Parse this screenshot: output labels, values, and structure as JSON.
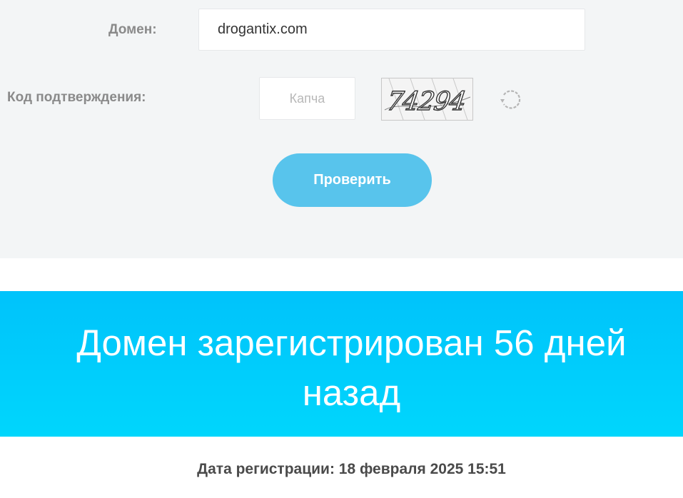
{
  "form": {
    "domain_label": "Домен:",
    "domain_value": "drogantix.com",
    "code_label": "Код подтверждения:",
    "captcha_placeholder": "Капча",
    "captcha_code": "74294",
    "submit_label": "Проверить"
  },
  "result": {
    "headline": "Домен зарегистрирован 56 дней назад",
    "registration_date": "Дата регистрации: 18 февраля 2025 15:51"
  },
  "colors": {
    "button": "#58c4ec",
    "banner": "#00c8fb",
    "panel": "#f3f5f6"
  },
  "icons": {
    "refresh": "refresh-icon"
  }
}
